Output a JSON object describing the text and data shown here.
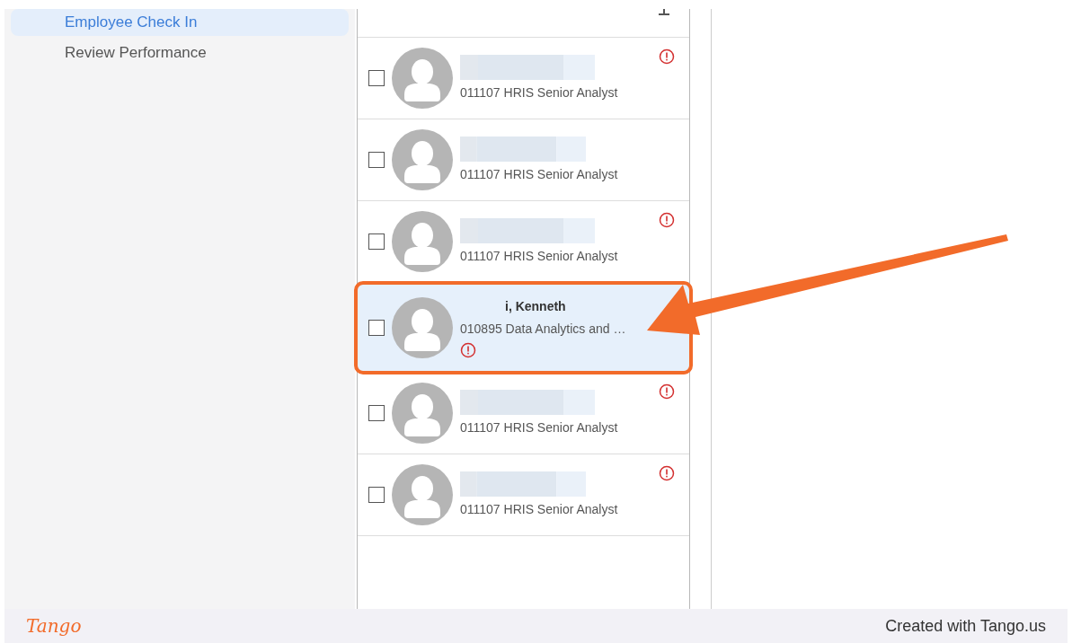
{
  "sidebar": {
    "items": [
      {
        "label": "Employee Check In",
        "selected": true
      },
      {
        "label": "Review Performance",
        "selected": false
      }
    ]
  },
  "employees": [
    {
      "title": "011107 HRIS Senior Analyst",
      "alert": true,
      "checked": false,
      "selected": false
    },
    {
      "title": "011107 HRIS Senior Analyst",
      "alert": false,
      "checked": false,
      "selected": false
    },
    {
      "title": "011107 HRIS Senior Analyst",
      "alert": true,
      "checked": false,
      "selected": false
    },
    {
      "name": "i, Kenneth",
      "title": "010895 Data Analytics and …",
      "alert": true,
      "checked": false,
      "selected": true
    },
    {
      "title": "011107 HRIS Senior Analyst",
      "alert": true,
      "checked": false,
      "selected": false
    },
    {
      "title": "011107 HRIS Senior Analyst",
      "alert": true,
      "checked": false,
      "selected": false
    }
  ],
  "footer": {
    "logo": "Tango",
    "credit": "Created with Tango.us"
  }
}
